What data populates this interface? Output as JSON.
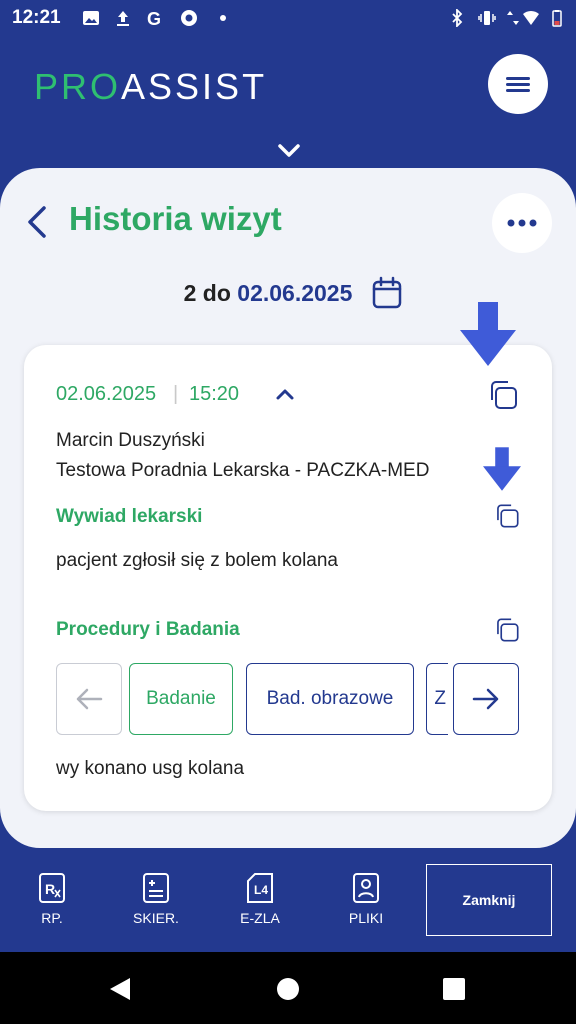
{
  "status": {
    "time": "12:21"
  },
  "header": {
    "logo_left": "PRO",
    "logo_right": "ASSIST"
  },
  "page": {
    "title": "Historia wizyt"
  },
  "date_range": {
    "from": "2",
    "between": "do",
    "to": "02.06.2025"
  },
  "visit": {
    "date": "02.06.2025",
    "separator": "|",
    "time": "15:20",
    "doctor": "Marcin Duszyński",
    "clinic": "Testowa Poradnia Lekarska - PACZKA-MED",
    "interview_title": "Wywiad lekarski",
    "interview_text": "pacjent zgłosił się z bolem kolana",
    "procedures_title": "Procedury i Badania",
    "chips": [
      "Badanie",
      "Bad. obrazowe",
      "Z"
    ],
    "procedures_text": "wy konano usg kolana"
  },
  "toolbar": {
    "items": [
      "RP.",
      "SKIER.",
      "E-ZLA",
      "PLIKI"
    ],
    "close_label": "Zamknij"
  },
  "colors": {
    "brand_blue": "#23398f",
    "accent_green": "#2ea864",
    "arrow_blue": "#3f5bd8"
  },
  "icons": [
    "image-icon",
    "upload-icon",
    "google-icon",
    "chrome-icon",
    "bluetooth-icon",
    "vibrate-icon",
    "data-icon",
    "wifi-icon",
    "battery-icon",
    "menu-icon",
    "chevron-down-icon",
    "back-icon",
    "more-icon",
    "calendar-icon",
    "chevron-up-icon",
    "copy-icon",
    "arrow-down-icon",
    "arrow-left-icon",
    "arrow-right-icon",
    "prescription-icon",
    "referral-icon",
    "sick-leave-icon",
    "files-icon"
  ]
}
